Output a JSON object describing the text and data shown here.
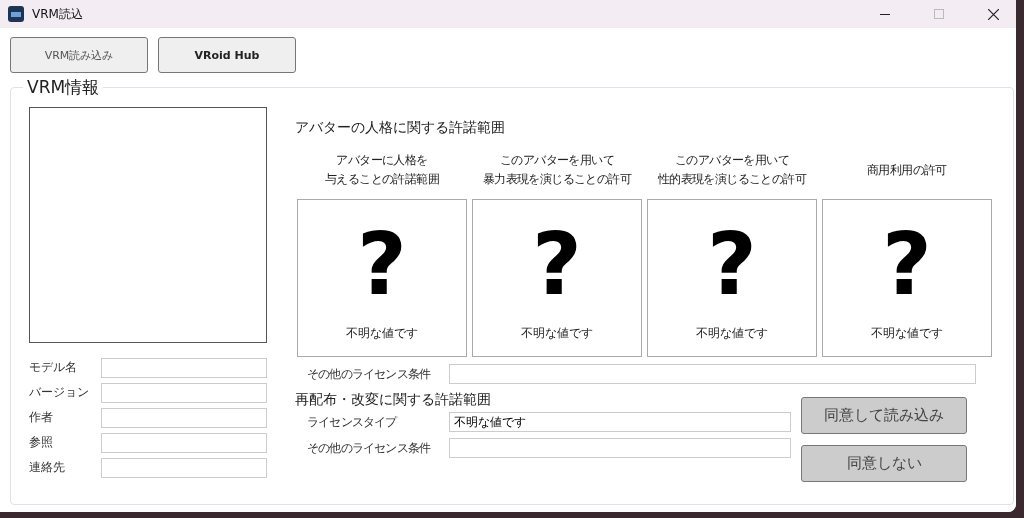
{
  "window": {
    "title": "VRM読込"
  },
  "toolbar": [
    "VRM読み込み",
    "VRoid Hub"
  ],
  "group": {
    "title": "VRM情報"
  },
  "fields": [
    {
      "label": "モデル名"
    },
    {
      "label": "バージョン"
    },
    {
      "label": "作者"
    },
    {
      "label": "参照"
    },
    {
      "label": "連絡先"
    }
  ],
  "personality": {
    "title": "アバターの人格に関する許諾範囲",
    "permissions": [
      {
        "heading": [
          "アバターに人格を",
          "与えることの許諾範囲"
        ],
        "symbol": "?",
        "value": "不明な値です"
      },
      {
        "heading": [
          "このアバターを用いて",
          "暴力表現を演じることの許可"
        ],
        "symbol": "?",
        "value": "不明な値です"
      },
      {
        "heading": [
          "このアバターを用いて",
          "性的表現を演じることの許可"
        ],
        "symbol": "?",
        "value": "不明な値です"
      },
      {
        "heading": [
          "商用利用の許可"
        ],
        "symbol": "?",
        "value": "不明な値です"
      }
    ],
    "other_conditions": {
      "label": "その他のライセンス条件"
    }
  },
  "redistribution": {
    "title": "再配布・改変に関する許諾範囲",
    "rows": [
      {
        "label": "ライセンスタイプ",
        "value": "不明な値です"
      },
      {
        "label": "その他のライセンス条件"
      }
    ]
  },
  "actions": [
    "同意して読み込み",
    "同意しない"
  ]
}
